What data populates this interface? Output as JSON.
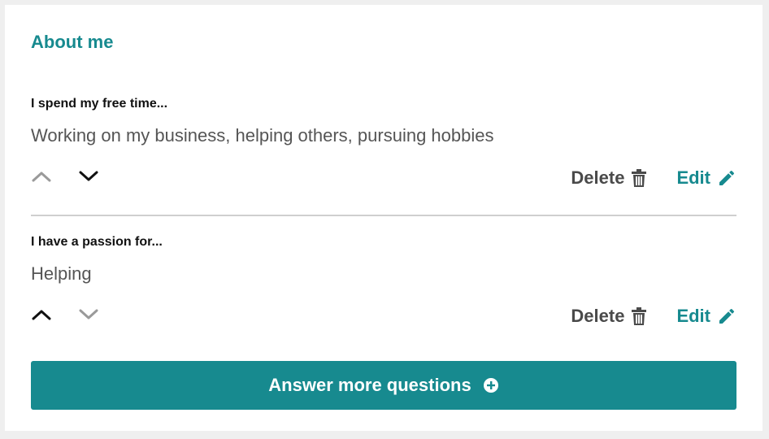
{
  "section": {
    "title": "About me"
  },
  "questions": [
    {
      "prompt": "I spend my free time...",
      "answer": "Working on my business, helping others, pursuing hobbies",
      "delete_label": "Delete",
      "edit_label": "Edit"
    },
    {
      "prompt": "I have a passion for...",
      "answer": "Helping",
      "delete_label": "Delete",
      "edit_label": "Edit"
    }
  ],
  "cta": {
    "label": "Answer more questions"
  },
  "colors": {
    "accent": "#178a8f",
    "text_dark": "#111111",
    "text_muted": "#555555",
    "arrow_disabled": "#9a9a9a",
    "arrow_enabled": "#111111"
  },
  "icons": {
    "move_up": "chevron-up-icon",
    "move_down": "chevron-down-icon",
    "delete": "trash-icon",
    "edit": "pencil-icon",
    "add": "plus-circle-icon"
  }
}
